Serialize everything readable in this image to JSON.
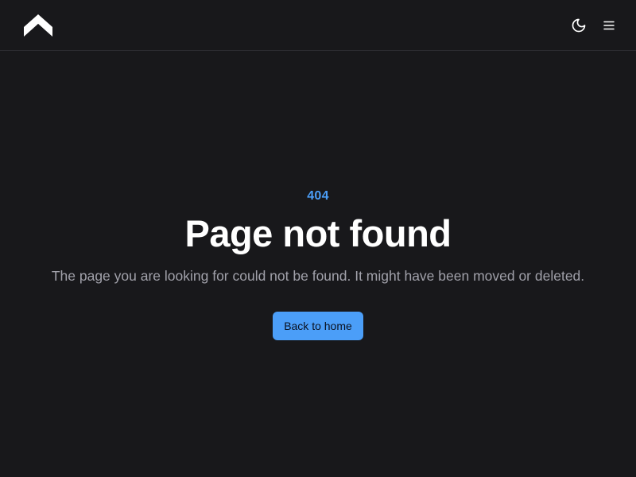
{
  "header": {
    "logo_icon": "mountain-logo-icon",
    "theme_toggle_icon": "moon-icon",
    "menu_icon": "hamburger-menu-icon"
  },
  "error": {
    "code": "404",
    "title": "Page not found",
    "description": "The page you are looking for could not be found. It might have been moved or deleted.",
    "button_label": "Back to home"
  },
  "colors": {
    "background": "#18181b",
    "accent": "#4b9ef8",
    "muted_text": "#a1a1aa",
    "border": "#2b2b30"
  }
}
